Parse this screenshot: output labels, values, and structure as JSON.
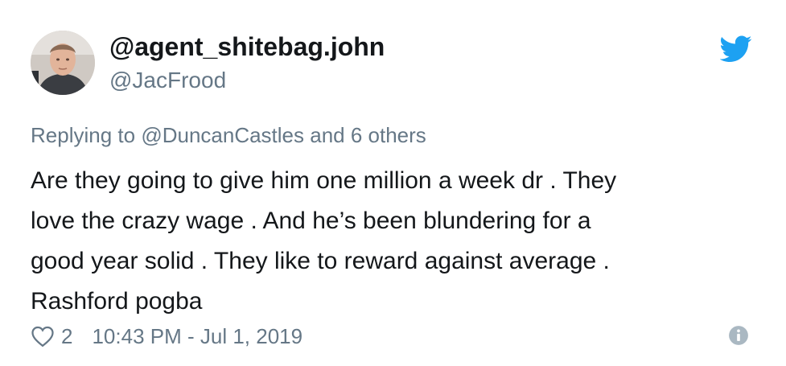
{
  "user": {
    "display_name": "@agent_shitebag.john",
    "handle": "@JacFrood"
  },
  "reply": {
    "prefix": "Replying to ",
    "mention": "@DuncanCastles",
    "suffix": " and 6 others"
  },
  "tweet": {
    "lines": [
      "Are they going to give him one million a week dr . They",
      "love the crazy wage . And he’s been blundering for a",
      "good year solid . They like to reward against average .",
      "Rashford pogba"
    ]
  },
  "footer": {
    "like_count": "2",
    "timestamp": "10:43 PM - Jul 1, 2019"
  },
  "icons": {
    "brand": "twitter-bird-icon",
    "like": "heart-icon",
    "info": "info-icon"
  },
  "colors": {
    "text": "#14171a",
    "secondary": "#657786",
    "twitter_blue": "#1da1f2",
    "info_gray": "#aab8c2"
  }
}
